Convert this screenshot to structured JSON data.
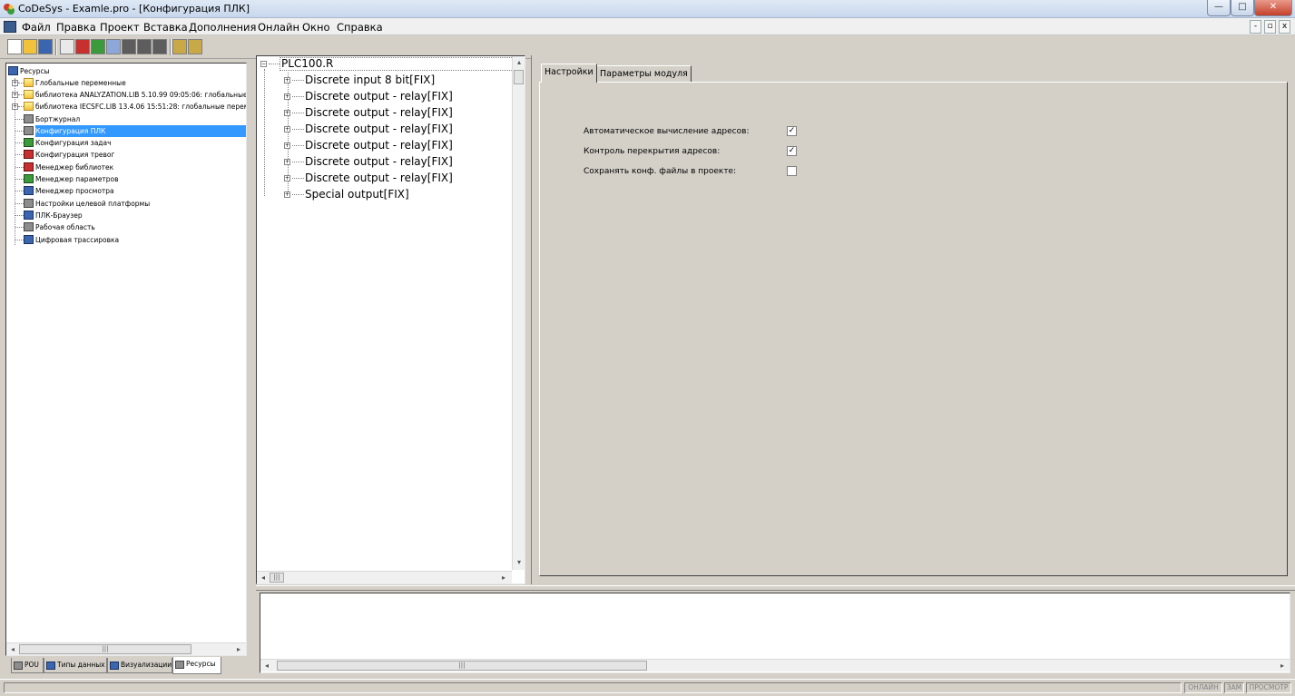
{
  "window": {
    "title": "CoDeSys - Examle.pro - [Конфигурация ПЛК]",
    "min": "—",
    "max": "□",
    "close": "✕",
    "mdi_min": "-",
    "mdi_restore": "▫",
    "mdi_close": "x"
  },
  "menu": [
    "Файл",
    "Правка",
    "Проект",
    "Вставка",
    "Дополнения",
    "Онлайн",
    "Окно",
    "Справка"
  ],
  "resource_tree": {
    "root": "Ресурсы",
    "items": [
      {
        "label": "Глобальные переменные",
        "icon": "folder-icon",
        "expandable": true
      },
      {
        "label": "библиотека ANALYZATION.LIB 5.10.99 09:05:06: глобальные",
        "icon": "folder-icon",
        "expandable": true
      },
      {
        "label": "библиотека IECSFC.LIB 13.4.06 15:51:28: глобальные переме",
        "icon": "folder-icon",
        "expandable": true
      },
      {
        "label": "Бортжурнал",
        "icon": "logbook-icon",
        "expandable": false
      },
      {
        "label": "Конфигурация ПЛК",
        "icon": "plc-config-icon",
        "expandable": false,
        "selected": true
      },
      {
        "label": "Конфигурация задач",
        "icon": "task-config-icon",
        "expandable": false
      },
      {
        "label": "Конфигурация тревог",
        "icon": "alarm-config-icon",
        "expandable": false
      },
      {
        "label": "Менеджер библиотек",
        "icon": "library-manager-icon",
        "expandable": false
      },
      {
        "label": "Менеджер параметров",
        "icon": "parameter-manager-icon",
        "expandable": false
      },
      {
        "label": "Менеджер просмотра",
        "icon": "watch-manager-icon",
        "expandable": false
      },
      {
        "label": "Настройки целевой платформы",
        "icon": "target-settings-icon",
        "expandable": false
      },
      {
        "label": "ПЛК-Браузер",
        "icon": "plc-browser-icon",
        "expandable": false
      },
      {
        "label": "Рабочая область",
        "icon": "workspace-icon",
        "expandable": false
      },
      {
        "label": "Цифровая трассировка",
        "icon": "trace-icon",
        "expandable": false
      }
    ]
  },
  "left_tabs": [
    {
      "label": "POU",
      "icon": "pou-icon"
    },
    {
      "label": "Типы данных",
      "icon": "data-types-icon"
    },
    {
      "label": "Визуализации",
      "icon": "visualization-icon"
    },
    {
      "label": "Ресурсы",
      "icon": "resources-icon",
      "active": true
    }
  ],
  "plc_tree": {
    "root": "PLC100.R",
    "modules": [
      "Discrete input 8 bit[FIX]",
      "Discrete output - relay[FIX]",
      "Discrete output - relay[FIX]",
      "Discrete output - relay[FIX]",
      "Discrete output - relay[FIX]",
      "Discrete output - relay[FIX]",
      "Discrete output - relay[FIX]",
      "Special output[FIX]"
    ]
  },
  "settings": {
    "tabs": [
      "Настройки",
      "Параметры модуля"
    ],
    "options": [
      {
        "label": "Автоматическое вычисление адресов:",
        "checked": true
      },
      {
        "label": "Контроль перекрытия адресов:",
        "checked": true
      },
      {
        "label": "Сохранять конф. файлы в проекте:",
        "checked": false
      }
    ]
  },
  "scrollbar": {
    "left": "◂",
    "right": "▸",
    "up": "▴",
    "down": "▾",
    "thumb": "|||"
  },
  "tree_glyph": {
    "plus": "+",
    "minus": "−"
  },
  "status": [
    "ОНЛАЙН",
    "ЗАМ",
    "ПРОСМОТР"
  ]
}
